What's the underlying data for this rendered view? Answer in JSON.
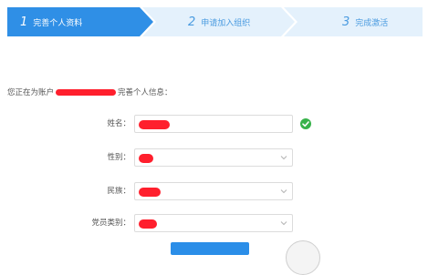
{
  "steps": [
    {
      "num": "1",
      "label": "完善个人资料",
      "active": true
    },
    {
      "num": "2",
      "label": "申请加入组织",
      "active": false
    },
    {
      "num": "3",
      "label": "完成激活",
      "active": false
    }
  ],
  "intro": {
    "prefix": "您正在为账户",
    "suffix": "完善个人信息："
  },
  "form": {
    "name_label": "姓名：",
    "gender_label": "性别：",
    "ethnicity_label": "民族：",
    "member_type_label": "党员类别："
  },
  "colors": {
    "active_step": "#2f8fe6",
    "inactive_step": "#e4f1fc",
    "redaction": "#ff1f2d",
    "success": "#37b24a"
  },
  "icons": {
    "name_valid": "check-circle-icon",
    "select": "chevron-down-icon"
  }
}
